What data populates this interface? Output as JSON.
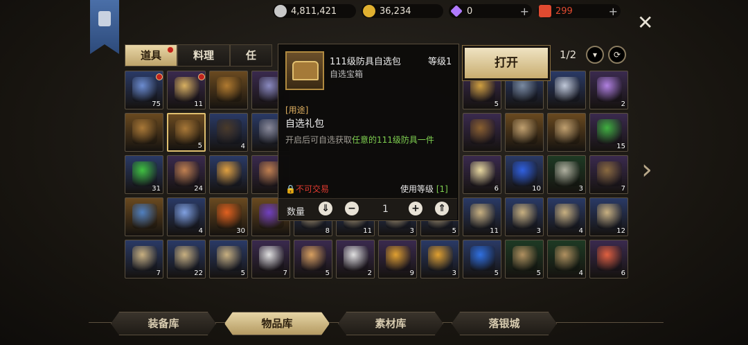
{
  "currency": [
    {
      "name": "silver",
      "icon": "silver-coin-icon",
      "value": "4,811,421",
      "color": "#c8c8c8"
    },
    {
      "name": "gold",
      "icon": "gold-coin-icon",
      "value": "36,234",
      "color": "#e0b030"
    },
    {
      "name": "gem",
      "icon": "diamond-icon",
      "value": "0",
      "color": "#b07aff"
    },
    {
      "name": "ticket",
      "icon": "ticket-icon",
      "value": "299",
      "color": "#e04a30"
    }
  ],
  "tabs": [
    "道具",
    "料理",
    "任"
  ],
  "page": "1/2",
  "popup": {
    "name": "111级防具自选包",
    "level": "等级1",
    "type": "自选宝箱",
    "usage_tag": "[用途]",
    "header": "自选礼包",
    "desc_prefix": "开启后可自选获取",
    "desc_highlight": "任意的111级防具一件",
    "trade": "不可交易",
    "use_level_label": "使用等级",
    "use_level_value": "[1]",
    "qty_label": "数量",
    "qty_value": "1"
  },
  "open_button": "打开",
  "bottom_nav": [
    "装备库",
    "物品库",
    "素材库",
    "落银城"
  ],
  "grid": [
    {
      "c": "#2a3a66",
      "s": "#6c8cd0",
      "n": "75",
      "dot": true
    },
    {
      "c": "#3a2a4e",
      "s": "#d8b060",
      "n": "11",
      "dot": true
    },
    {
      "c": "#6a4a20",
      "s": "#b07a30",
      "n": ""
    },
    {
      "c": "#3a2a4e",
      "s": "#8a8ac0",
      "n": ""
    },
    {
      "c": "#1a1a1a",
      "s": "#1a1a1a",
      "n": "",
      "hidden": true
    },
    {
      "c": "#1a1a1a",
      "s": "#1a1a1a",
      "n": "",
      "hidden": true
    },
    {
      "c": "#1a1a1a",
      "s": "#1a1a1a",
      "n": "",
      "hidden": true
    },
    {
      "c": "#1a1a1a",
      "s": "#1a1a1a",
      "n": "",
      "hidden": true
    },
    {
      "c": "#3a2a4e",
      "s": "#d0a040",
      "n": "5"
    },
    {
      "c": "#2a3a66",
      "s": "#7a8aa0",
      "n": ""
    },
    {
      "c": "#2a3a66",
      "s": "#c0c8d8",
      "n": ""
    },
    {
      "c": "#3a2a4e",
      "s": "#b080e0",
      "n": "2"
    },
    {
      "c": "#6a4a20",
      "s": "#a87838",
      "n": ""
    },
    {
      "c": "#6a4a20",
      "s": "#a87838",
      "n": "5",
      "sel": true
    },
    {
      "c": "#2a3a66",
      "s": "#4a3a2a",
      "n": "4"
    },
    {
      "c": "#2a3a66",
      "s": "#8a8a9a",
      "n": ""
    },
    {
      "c": "#1a1a1a",
      "s": "#1a1a1a",
      "n": "",
      "hidden": true
    },
    {
      "c": "#1a1a1a",
      "s": "#1a1a1a",
      "n": "",
      "hidden": true
    },
    {
      "c": "#1a1a1a",
      "s": "#1a1a1a",
      "n": "",
      "hidden": true
    },
    {
      "c": "#1a1a1a",
      "s": "#1a1a1a",
      "n": "",
      "hidden": true
    },
    {
      "c": "#3a2a4e",
      "s": "#8a6030",
      "n": ""
    },
    {
      "c": "#6a4a20",
      "s": "#c0a070",
      "n": ""
    },
    {
      "c": "#6a4a20",
      "s": "#c0a070",
      "n": ""
    },
    {
      "c": "#3a2a4e",
      "s": "#40b040",
      "n": "15"
    },
    {
      "c": "#2a3a66",
      "s": "#40c040",
      "n": "31"
    },
    {
      "c": "#3a2a4e",
      "s": "#c08050",
      "n": "24"
    },
    {
      "c": "#2a3a66",
      "s": "#e0a040",
      "n": ""
    },
    {
      "c": "#3a2a4e",
      "s": "#c08050",
      "n": ""
    },
    {
      "c": "#1a1a1a",
      "s": "#1a1a1a",
      "n": "",
      "hidden": true
    },
    {
      "c": "#1a1a1a",
      "s": "#1a1a1a",
      "n": "",
      "hidden": true
    },
    {
      "c": "#1a1a1a",
      "s": "#1a1a1a",
      "n": "",
      "hidden": true
    },
    {
      "c": "#1a1a1a",
      "s": "#1a1a1a",
      "n": "",
      "hidden": true
    },
    {
      "c": "#3a2a4e",
      "s": "#e8d8a0",
      "n": "6"
    },
    {
      "c": "#2a3a66",
      "s": "#3060e0",
      "n": "10"
    },
    {
      "c": "#1e3a24",
      "s": "#b0b0a0",
      "n": "3"
    },
    {
      "c": "#3a2a4e",
      "s": "#8a6a40",
      "n": "7"
    },
    {
      "c": "#6a4a20",
      "s": "#5080c0",
      "n": ""
    },
    {
      "c": "#2a3a66",
      "s": "#80a0e0",
      "n": "4"
    },
    {
      "c": "#6a4a20",
      "s": "#e06020",
      "n": "30"
    },
    {
      "c": "#6a4a20",
      "s": "#7040c0",
      "n": ""
    },
    {
      "c": "#2a3a66",
      "s": "#c8b080",
      "n": "8"
    },
    {
      "c": "#2a3a66",
      "s": "#c8b080",
      "n": "11"
    },
    {
      "c": "#2a3a66",
      "s": "#c8b080",
      "n": "3"
    },
    {
      "c": "#2a3a66",
      "s": "#c8b080",
      "n": "5"
    },
    {
      "c": "#2a3a66",
      "s": "#c8b080",
      "n": "11"
    },
    {
      "c": "#2a3a66",
      "s": "#c8b080",
      "n": "3"
    },
    {
      "c": "#2a3a66",
      "s": "#c8b080",
      "n": "4"
    },
    {
      "c": "#2a3a66",
      "s": "#c8b080",
      "n": "12"
    },
    {
      "c": "#2a3a66",
      "s": "#c8b080",
      "n": "7"
    },
    {
      "c": "#2a3a66",
      "s": "#c8b080",
      "n": "22"
    },
    {
      "c": "#2a3a66",
      "s": "#c8b080",
      "n": "5"
    },
    {
      "c": "#3a2a4e",
      "s": "#e0e0e0",
      "n": "7"
    },
    {
      "c": "#3a2a4e",
      "s": "#d8a060",
      "n": "5"
    },
    {
      "c": "#3a2a4e",
      "s": "#e0e0e0",
      "n": "2"
    },
    {
      "c": "#3a2a4e",
      "s": "#e0a030",
      "n": "9"
    },
    {
      "c": "#2a3a66",
      "s": "#e0a030",
      "n": "3"
    },
    {
      "c": "#2a3a66",
      "s": "#3070e0",
      "n": "5"
    },
    {
      "c": "#1e3a24",
      "s": "#b09060",
      "n": "5"
    },
    {
      "c": "#1e3a24",
      "s": "#b09060",
      "n": "4"
    },
    {
      "c": "#3a2a4e",
      "s": "#e06040",
      "n": "6"
    }
  ]
}
